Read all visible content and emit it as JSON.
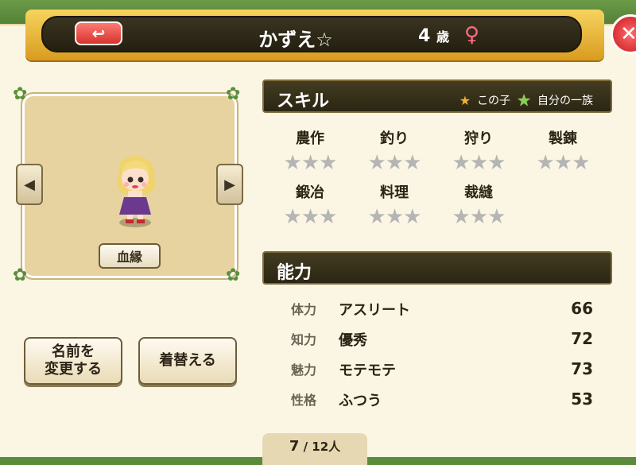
{
  "header": {
    "back_icon": "↩",
    "name": "かずえ☆",
    "age_num": "4",
    "age_unit": "歳",
    "gender_symbol": "♀",
    "close_icon": "✕"
  },
  "portrait": {
    "lineage_button": "血縁",
    "prev_icon": "◀",
    "next_icon": "▶"
  },
  "buttons": {
    "rename_line1": "名前を",
    "rename_line2": "変更する",
    "change_clothes": "着替える"
  },
  "skills": {
    "title": "スキル",
    "legend_self": "この子",
    "legend_clan": "自分の一族",
    "items": [
      {
        "label": "農作",
        "stars": "★★★"
      },
      {
        "label": "釣り",
        "stars": "★★★"
      },
      {
        "label": "狩り",
        "stars": "★★★"
      },
      {
        "label": "製錬",
        "stars": "★★★"
      },
      {
        "label": "鍛冶",
        "stars": "★★★"
      },
      {
        "label": "料理",
        "stars": "★★★"
      },
      {
        "label": "裁縫",
        "stars": "★★★"
      }
    ]
  },
  "abilities": {
    "title": "能力",
    "rows": [
      {
        "key": "体力",
        "value": "アスリート",
        "num": "66"
      },
      {
        "key": "知力",
        "value": "優秀",
        "num": "72"
      },
      {
        "key": "魅力",
        "value": "モテモテ",
        "num": "73"
      },
      {
        "key": "性格",
        "value": "ふつう",
        "num": "53"
      }
    ]
  },
  "pager": {
    "current": "7",
    "sep": " / ",
    "total": "12人"
  },
  "colors": {
    "accent_gold": "#d99b1f",
    "header_dark": "#2b2612",
    "female": "#ff6b86",
    "star_empty": "#b5b5b5"
  }
}
